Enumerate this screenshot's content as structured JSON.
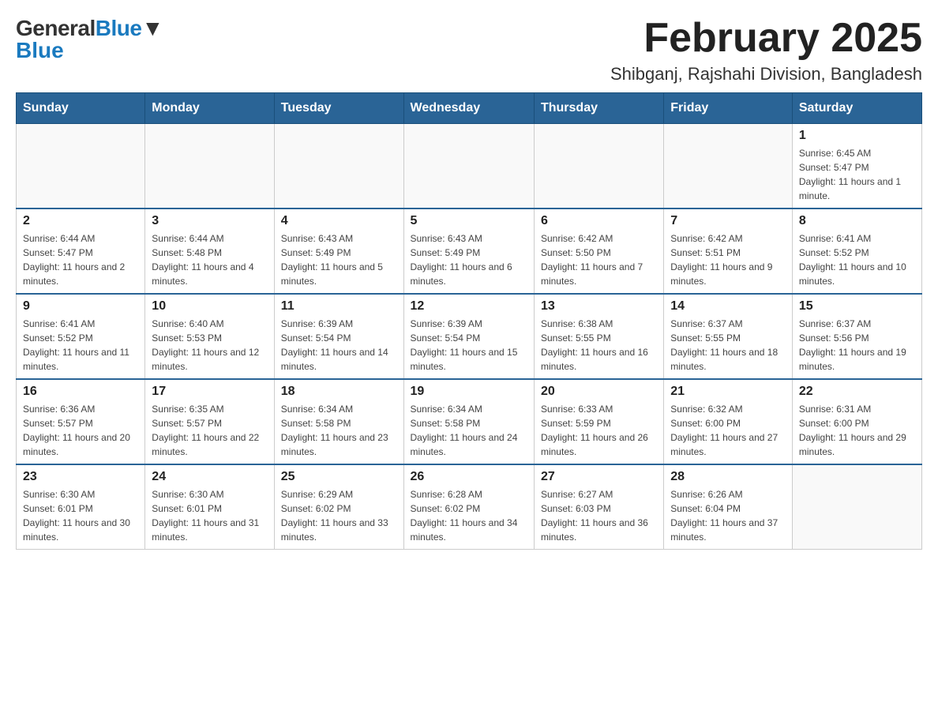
{
  "header": {
    "logo_general": "General",
    "logo_blue": "Blue",
    "title": "February 2025",
    "subtitle": "Shibganj, Rajshahi Division, Bangladesh"
  },
  "weekdays": [
    "Sunday",
    "Monday",
    "Tuesday",
    "Wednesday",
    "Thursday",
    "Friday",
    "Saturday"
  ],
  "weeks": [
    [
      {
        "day": "",
        "info": ""
      },
      {
        "day": "",
        "info": ""
      },
      {
        "day": "",
        "info": ""
      },
      {
        "day": "",
        "info": ""
      },
      {
        "day": "",
        "info": ""
      },
      {
        "day": "",
        "info": ""
      },
      {
        "day": "1",
        "info": "Sunrise: 6:45 AM\nSunset: 5:47 PM\nDaylight: 11 hours and 1 minute."
      }
    ],
    [
      {
        "day": "2",
        "info": "Sunrise: 6:44 AM\nSunset: 5:47 PM\nDaylight: 11 hours and 2 minutes."
      },
      {
        "day": "3",
        "info": "Sunrise: 6:44 AM\nSunset: 5:48 PM\nDaylight: 11 hours and 4 minutes."
      },
      {
        "day": "4",
        "info": "Sunrise: 6:43 AM\nSunset: 5:49 PM\nDaylight: 11 hours and 5 minutes."
      },
      {
        "day": "5",
        "info": "Sunrise: 6:43 AM\nSunset: 5:49 PM\nDaylight: 11 hours and 6 minutes."
      },
      {
        "day": "6",
        "info": "Sunrise: 6:42 AM\nSunset: 5:50 PM\nDaylight: 11 hours and 7 minutes."
      },
      {
        "day": "7",
        "info": "Sunrise: 6:42 AM\nSunset: 5:51 PM\nDaylight: 11 hours and 9 minutes."
      },
      {
        "day": "8",
        "info": "Sunrise: 6:41 AM\nSunset: 5:52 PM\nDaylight: 11 hours and 10 minutes."
      }
    ],
    [
      {
        "day": "9",
        "info": "Sunrise: 6:41 AM\nSunset: 5:52 PM\nDaylight: 11 hours and 11 minutes."
      },
      {
        "day": "10",
        "info": "Sunrise: 6:40 AM\nSunset: 5:53 PM\nDaylight: 11 hours and 12 minutes."
      },
      {
        "day": "11",
        "info": "Sunrise: 6:39 AM\nSunset: 5:54 PM\nDaylight: 11 hours and 14 minutes."
      },
      {
        "day": "12",
        "info": "Sunrise: 6:39 AM\nSunset: 5:54 PM\nDaylight: 11 hours and 15 minutes."
      },
      {
        "day": "13",
        "info": "Sunrise: 6:38 AM\nSunset: 5:55 PM\nDaylight: 11 hours and 16 minutes."
      },
      {
        "day": "14",
        "info": "Sunrise: 6:37 AM\nSunset: 5:55 PM\nDaylight: 11 hours and 18 minutes."
      },
      {
        "day": "15",
        "info": "Sunrise: 6:37 AM\nSunset: 5:56 PM\nDaylight: 11 hours and 19 minutes."
      }
    ],
    [
      {
        "day": "16",
        "info": "Sunrise: 6:36 AM\nSunset: 5:57 PM\nDaylight: 11 hours and 20 minutes."
      },
      {
        "day": "17",
        "info": "Sunrise: 6:35 AM\nSunset: 5:57 PM\nDaylight: 11 hours and 22 minutes."
      },
      {
        "day": "18",
        "info": "Sunrise: 6:34 AM\nSunset: 5:58 PM\nDaylight: 11 hours and 23 minutes."
      },
      {
        "day": "19",
        "info": "Sunrise: 6:34 AM\nSunset: 5:58 PM\nDaylight: 11 hours and 24 minutes."
      },
      {
        "day": "20",
        "info": "Sunrise: 6:33 AM\nSunset: 5:59 PM\nDaylight: 11 hours and 26 minutes."
      },
      {
        "day": "21",
        "info": "Sunrise: 6:32 AM\nSunset: 6:00 PM\nDaylight: 11 hours and 27 minutes."
      },
      {
        "day": "22",
        "info": "Sunrise: 6:31 AM\nSunset: 6:00 PM\nDaylight: 11 hours and 29 minutes."
      }
    ],
    [
      {
        "day": "23",
        "info": "Sunrise: 6:30 AM\nSunset: 6:01 PM\nDaylight: 11 hours and 30 minutes."
      },
      {
        "day": "24",
        "info": "Sunrise: 6:30 AM\nSunset: 6:01 PM\nDaylight: 11 hours and 31 minutes."
      },
      {
        "day": "25",
        "info": "Sunrise: 6:29 AM\nSunset: 6:02 PM\nDaylight: 11 hours and 33 minutes."
      },
      {
        "day": "26",
        "info": "Sunrise: 6:28 AM\nSunset: 6:02 PM\nDaylight: 11 hours and 34 minutes."
      },
      {
        "day": "27",
        "info": "Sunrise: 6:27 AM\nSunset: 6:03 PM\nDaylight: 11 hours and 36 minutes."
      },
      {
        "day": "28",
        "info": "Sunrise: 6:26 AM\nSunset: 6:04 PM\nDaylight: 11 hours and 37 minutes."
      },
      {
        "day": "",
        "info": ""
      }
    ]
  ]
}
